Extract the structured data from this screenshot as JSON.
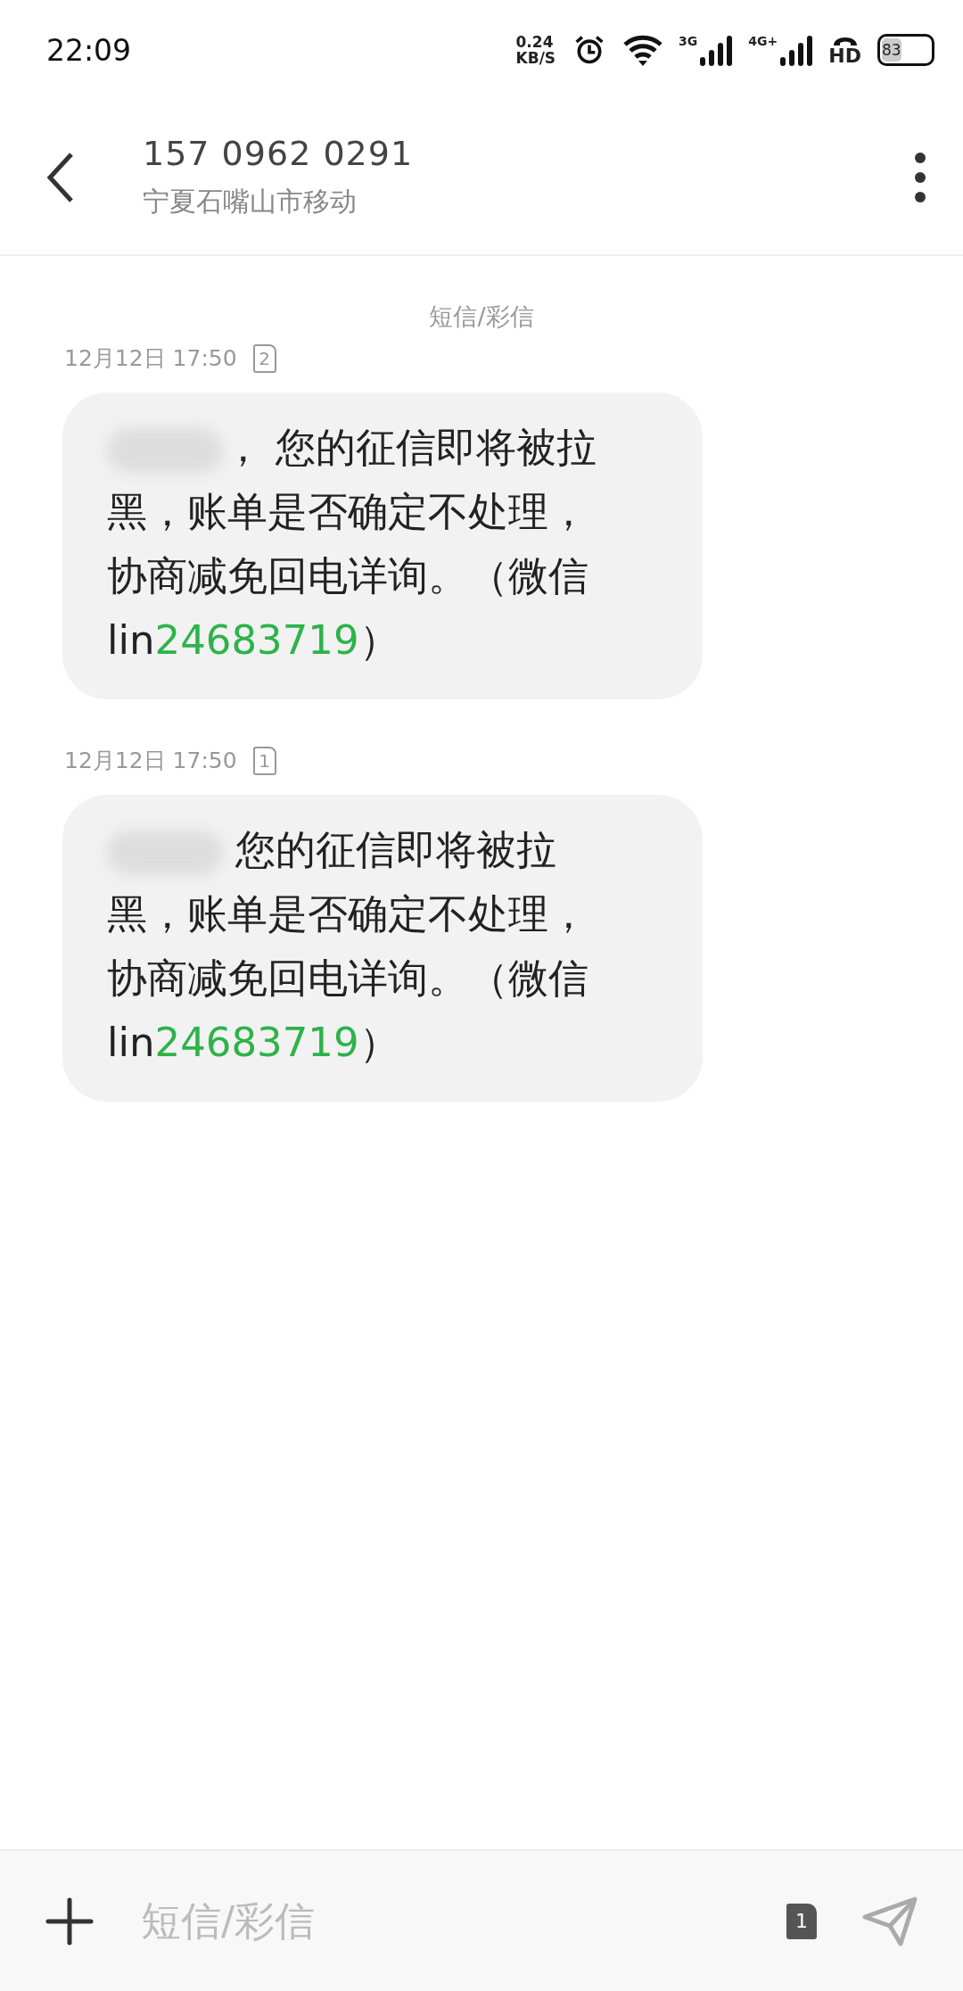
{
  "status_bar": {
    "time": "22:09",
    "net_speed": [
      "0.24",
      "KB/S"
    ],
    "signals": [
      {
        "label": "3G"
      },
      {
        "label": "4G+"
      }
    ],
    "call_label": "HD",
    "battery": "83"
  },
  "header": {
    "title": "157 0962 0291",
    "subtitle": "宁夏石嘴山市移动"
  },
  "thread": {
    "channel_label": "短信/彩信",
    "messages": [
      {
        "time": "12月12日 17:50",
        "sim": "2",
        "segments": [
          {
            "kind": "redacted"
          },
          {
            "kind": "text",
            "text": "，  您的征信即将被拉黑，账单是否确定不处理，协商减免回电详询。（微信lin"
          },
          {
            "kind": "number",
            "text": "24683719"
          },
          {
            "kind": "text",
            "text": "）"
          }
        ]
      },
      {
        "time": "12月12日 17:50",
        "sim": "1",
        "segments": [
          {
            "kind": "redacted"
          },
          {
            "kind": "text",
            "text": " 您的征信即将被拉黑，账单是否确定不处理，协商减免回电详询。（微信lin"
          },
          {
            "kind": "number",
            "text": "24683719"
          },
          {
            "kind": "text",
            "text": "）"
          }
        ]
      }
    ]
  },
  "composer": {
    "placeholder": "短信/彩信",
    "sim": "1"
  }
}
